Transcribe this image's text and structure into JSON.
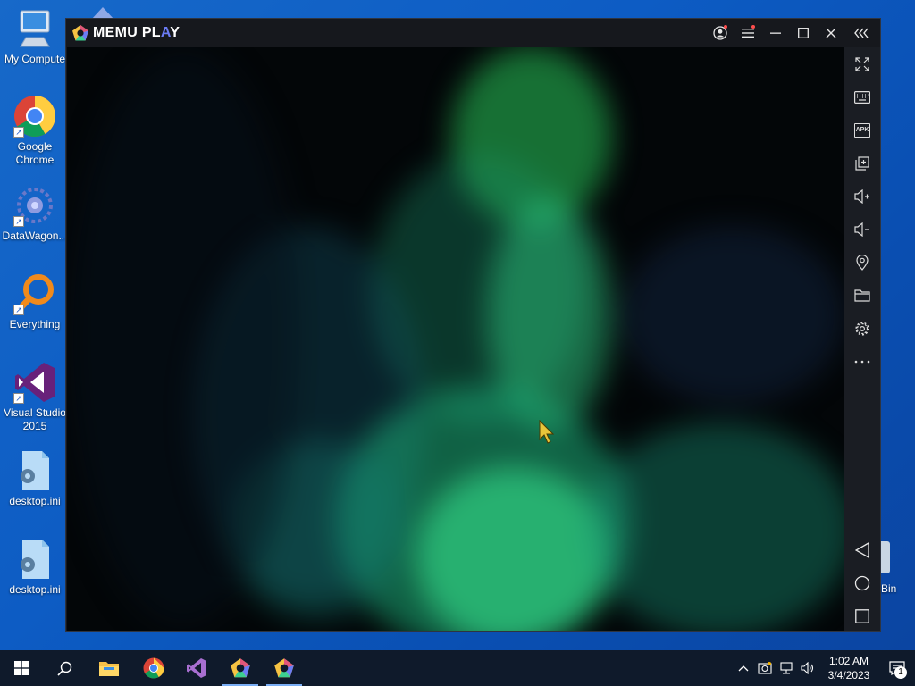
{
  "desktop": {
    "icons": [
      {
        "label": "My Compute",
        "icon": "computer-icon"
      },
      {
        "label": "Google Chrome",
        "icon": "chrome-icon"
      },
      {
        "label": "DataWagon...",
        "icon": "datawagon-icon"
      },
      {
        "label": "Everything",
        "icon": "everything-search-icon"
      },
      {
        "label": "Visual Studio 2015",
        "icon": "visual-studio-icon"
      },
      {
        "label": "desktop.ini",
        "icon": "settings-file-icon"
      },
      {
        "label": "desktop.ini",
        "icon": "settings-file-icon"
      }
    ],
    "recycle_bin_label": "Bin"
  },
  "memu": {
    "title": "MEMU PLAY",
    "accent_color": "#6b7cf5",
    "title_buttons": [
      "account-icon",
      "menu-icon",
      "minimize-icon",
      "maximize-icon",
      "close-icon",
      "collapse-sidebar-icon"
    ],
    "sidebar_buttons": [
      "fullscreen-icon",
      "keyboard-icon",
      "apk-icon",
      "multi-instance-icon",
      "volume-up-icon",
      "volume-down-icon",
      "location-icon",
      "folder-icon",
      "settings-icon",
      "more-icon"
    ],
    "apk_label": "APK",
    "nav_buttons": [
      "back-icon",
      "home-icon",
      "recent-apps-icon"
    ],
    "wallpaper": "aurora"
  },
  "taskbar": {
    "items": [
      "start-icon",
      "search-icon",
      "file-explorer-icon",
      "chrome-icon",
      "visual-studio-icon",
      "memu-icon",
      "memu-icon"
    ],
    "time": "1:02 AM",
    "date": "3/4/2023",
    "notification_count": "1"
  }
}
